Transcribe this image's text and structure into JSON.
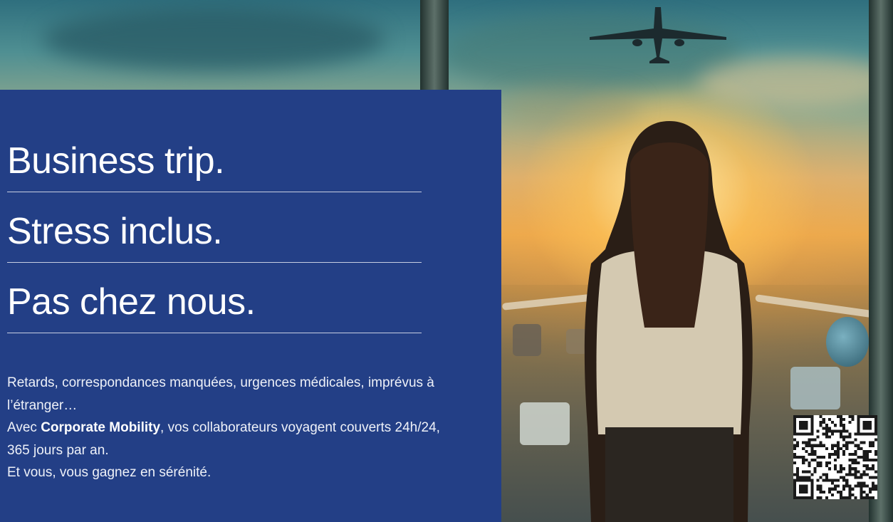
{
  "headlines": {
    "line1": "Business trip.",
    "line2": "Stress inclus.",
    "line3": "Pas chez nous."
  },
  "body": {
    "para1": "Retards, correspondances manquées, urgences médicales, imprévus à l’étranger…",
    "para2_prefix": "Avec ",
    "para2_brand": "Corporate Mobility",
    "para2_suffix": ", vos collaborateurs voyagent couverts 24h/24, 365 jours par an.",
    "para3": "Et vous, vous gagnez en sérénité."
  },
  "colors": {
    "panel": "#233f86",
    "text": "#ffffff",
    "sun": "#f2c46a"
  },
  "icons": {
    "qr": "qr-code-icon",
    "plane": "airplane-icon"
  }
}
